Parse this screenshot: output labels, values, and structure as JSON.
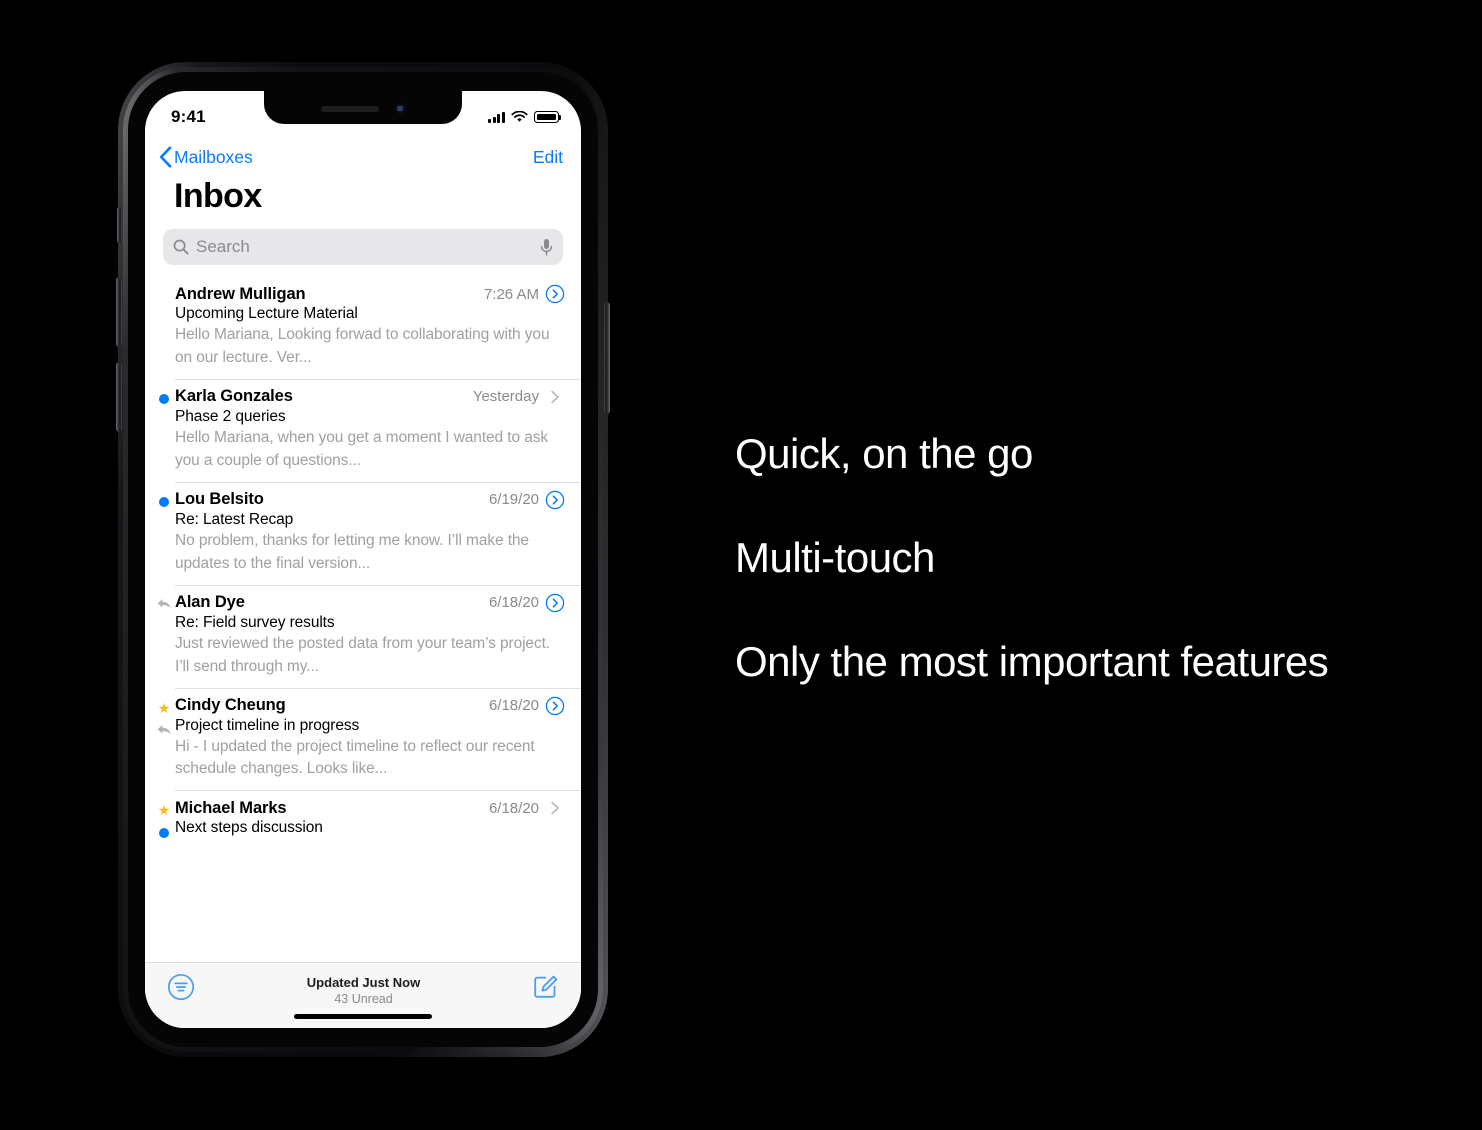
{
  "status_bar": {
    "time": "9:41",
    "signal_icon": "cellular-signal-icon",
    "wifi_icon": "wifi-icon",
    "battery_icon": "battery-icon"
  },
  "nav": {
    "back_label": "Mailboxes",
    "back_icon": "chevron-left-icon",
    "edit_label": "Edit"
  },
  "page_title": "Inbox",
  "search": {
    "placeholder": "Search",
    "value": "",
    "search_icon": "search-icon",
    "mic_icon": "microphone-icon"
  },
  "emails": [
    {
      "sender": "Andrew Mulligan",
      "subject": "Upcoming Lecture Material",
      "preview": "Hello Mariana, Looking forwad to collaborating with you on our lecture. Ver...",
      "date": "7:26 AM",
      "flag": "none",
      "sub_flag": "none",
      "accessory": "detail-circle"
    },
    {
      "sender": "Karla Gonzales",
      "subject": "Phase 2 queries",
      "preview": "Hello Mariana, when you get a moment I wanted to ask you a couple of questions...",
      "date": "Yesterday",
      "flag": "unread",
      "sub_flag": "none",
      "accessory": "chevron"
    },
    {
      "sender": "Lou Belsito",
      "subject": "Re: Latest Recap",
      "preview": "No problem, thanks for letting me know. I’ll make the updates to the final version...",
      "date": "6/19/20",
      "flag": "unread",
      "sub_flag": "none",
      "accessory": "detail-circle"
    },
    {
      "sender": "Alan Dye",
      "subject": "Re: Field survey results",
      "preview": "Just reviewed the posted data from your team’s project. I’ll send through my...",
      "date": "6/18/20",
      "flag": "replied",
      "sub_flag": "none",
      "accessory": "detail-circle"
    },
    {
      "sender": "Cindy Cheung",
      "subject": "Project timeline in progress",
      "preview": "Hi - I updated the project timeline to reflect our recent schedule changes. Looks like...",
      "date": "6/18/20",
      "flag": "flagged",
      "sub_flag": "replied",
      "accessory": "detail-circle"
    },
    {
      "sender": "Michael Marks",
      "subject": "Next steps discussion",
      "preview": "",
      "date": "6/18/20",
      "flag": "flagged",
      "sub_flag": "unread",
      "accessory": "chevron"
    }
  ],
  "toolbar": {
    "filter_icon": "filter-icon",
    "status_main": "Updated Just Now",
    "status_sub": "43 Unread",
    "compose_icon": "compose-icon"
  },
  "callouts": [
    "Quick, on the go",
    "Multi-touch",
    "Only the most important features"
  ],
  "colors": {
    "accent_blue": "#007aff",
    "flag_yellow": "#f8bb1c",
    "secondary_gray": "#8a8a8e",
    "preview_gray": "#a0a0a4",
    "background": "#000000"
  }
}
